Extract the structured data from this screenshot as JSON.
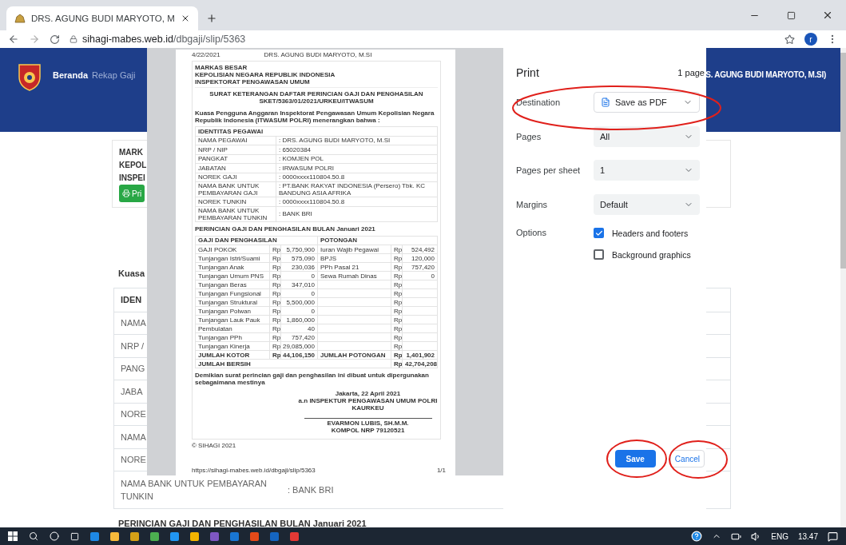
{
  "browser": {
    "tab": {
      "title": "DRS. AGUNG BUDI MARYOTO, M"
    },
    "url_host": "sihagi-mabes.web.id",
    "url_path": "/dbgaji/slip/5363",
    "profile": "r"
  },
  "site": {
    "nav": [
      {
        "label": "Beranda",
        "selected": true
      },
      {
        "label": "Rekap Gaji",
        "selected": false
      }
    ],
    "user": "S. AGUNG BUDI MARYOTO, M.SI)",
    "header_lines": [
      "MARK",
      "KEPOL",
      "INSPEI"
    ],
    "print_button": "Pri",
    "intro": "Kuasa",
    "table_rows": [
      {
        "kind": "heading",
        "label": "IDEN"
      },
      {
        "kind": "row",
        "label": "NAMA"
      },
      {
        "kind": "row",
        "label": "NRP /"
      },
      {
        "kind": "row",
        "label": "PANG"
      },
      {
        "kind": "row",
        "label": "JABA"
      },
      {
        "kind": "row",
        "label": "NORE"
      },
      {
        "kind": "row",
        "label": "NAMA"
      },
      {
        "kind": "row",
        "label": "NORE"
      },
      {
        "kind": "row",
        "label": "NAMA BANK UNTUK PEMBAYARAN TUNKIN",
        "value": ": BANK BRI"
      }
    ],
    "section_title": "PERINCIAN GAJI DAN PENGHASILAN BULAN Januari 2021"
  },
  "preview": {
    "date": "4/22/2021",
    "doc_title": "DRS. AGUNG BUDI MARYOTO, M.SI",
    "org": [
      "MARKAS BESAR",
      "KEPOLISIAN NEGARA REPUBLIK INDONESIA",
      "INSPEKTORAT PENGAWASAN UMUM"
    ],
    "title": "SURAT KETERANGAN DAFTAR PERINCIAN GAJI DAN PENGHASILAN",
    "number": "SKET/5363/01/2021/URKEU/ITWASUM",
    "intro": "Kuasa Pengguna Anggaran Inspektorat Pengawasan Umum Kepolisian Negara Republik Indonesia (ITWASUM POLRI) menerangkan bahwa :",
    "identity_heading": "IDENTITAS PEGAWAI",
    "identity": [
      {
        "label": "NAMA PEGAWAI",
        "value": ": DRS. AGUNG BUDI MARYOTO, M.SI"
      },
      {
        "label": "NRP / NIP",
        "value": ": 65020384"
      },
      {
        "label": "PANGKAT",
        "value": ": KOMJEN POL"
      },
      {
        "label": "JABATAN",
        "value": ": IRWASUM POLRI"
      },
      {
        "label": "NOREK GAJI",
        "value": ": 0000xxxx110804.50.8"
      },
      {
        "label": "NAMA BANK UNTUK PEMBAYARAN GAJI",
        "value": ": PT.BANK RAKYAT INDONESIA (Persero) Tbk. KC BANDUNG ASIA AFRIKA"
      },
      {
        "label": "NOREK TUNKIN",
        "value": ": 0000xxxx110804.50.8"
      },
      {
        "label": "NAMA BANK UNTUK PEMBAYARAN TUNKIN",
        "value": ": BANK BRI"
      }
    ],
    "salary_title": "PERINCIAN GAJI DAN PENGHASILAN BULAN Januari 2021",
    "earnings_heading": "GAJI DAN PENGHASILAN",
    "deductions_heading": "POTONGAN",
    "rows": [
      {
        "kind": "item",
        "e_label": "GAJI POKOK",
        "e_cur": "Rp",
        "e_amt": "5,750,900",
        "d_label": "Iuran Wajib Pegawai",
        "d_cur": "Rp",
        "d_amt": "524,492"
      },
      {
        "kind": "item",
        "e_label": "Tunjangan Istri/Suami",
        "e_cur": "Rp",
        "e_amt": "575,090",
        "d_label": "BPJS",
        "d_cur": "Rp",
        "d_amt": "120,000"
      },
      {
        "kind": "item",
        "e_label": "Tunjangan Anak",
        "e_cur": "Rp",
        "e_amt": "230,036",
        "d_label": "PPh Pasal 21",
        "d_cur": "Rp",
        "d_amt": "757,420"
      },
      {
        "kind": "item",
        "e_label": "Tunjangan Umum PNS",
        "e_cur": "Rp",
        "e_amt": "0",
        "d_label": "Sewa Rumah Dinas",
        "d_cur": "Rp",
        "d_amt": "0"
      },
      {
        "kind": "item",
        "e_label": "Tunjangan Beras",
        "e_cur": "Rp",
        "e_amt": "347,010",
        "d_cur": "Rp"
      },
      {
        "kind": "item",
        "e_label": "Tunjangan Fungsional",
        "e_cur": "Rp",
        "e_amt": "0",
        "d_cur": "Rp"
      },
      {
        "kind": "item",
        "e_label": "Tunjangan Struktural",
        "e_cur": "Rp",
        "e_amt": "5,500,000",
        "d_cur": "Rp"
      },
      {
        "kind": "item",
        "e_label": "Tunjangan Polwan",
        "e_cur": "Rp",
        "e_amt": "0",
        "d_cur": "Rp"
      },
      {
        "kind": "item",
        "e_label": "Tunjangan Lauk Pauk",
        "e_cur": "Rp",
        "e_amt": "1,860,000",
        "d_cur": "Rp"
      },
      {
        "kind": "item",
        "e_label": "Pembulatan",
        "e_cur": "Rp",
        "e_amt": "40",
        "d_cur": "Rp"
      },
      {
        "kind": "item",
        "e_label": "Tunjangan PPh",
        "e_cur": "Rp",
        "e_amt": "757,420",
        "d_cur": "Rp"
      },
      {
        "kind": "item",
        "e_label": "Tunjangan Kinerja",
        "e_cur": "Rp",
        "e_amt": "29,085,000",
        "d_cur": "Rp"
      },
      {
        "kind": "total",
        "e_label": "JUMLAH KOTOR",
        "e_cur": "Rp",
        "e_amt": "44,106,150",
        "d_label": "JUMLAH POTONGAN",
        "d_cur": "Rp",
        "d_amt": "1,401,902"
      },
      {
        "kind": "net",
        "e_label": "JUMLAH BERSIH",
        "d_cur": "Rp",
        "d_amt": "42,704,208"
      }
    ],
    "statement": "Demikian surat perincian gaji dan penghasilan ini dibuat untuk dipergunakan sebagaimana mestinya",
    "signature": [
      "Jakarta, 22 April 2021",
      "a.n INSPEKTUR PENGAWASAN UMUM POLRI",
      "KAURKEU"
    ],
    "signer": [
      "EVARMON LUBIS, SH.M.M.",
      "KOMPOL NRP 79120521"
    ],
    "copyright": "© SIHAGI 2021",
    "footer_url": "https://sihagi-mabes.web.id/dbgaji/slip/5363",
    "footer_page": "1/1"
  },
  "print": {
    "title": "Print",
    "page_count": "1 page",
    "settings": [
      {
        "kind": "destination",
        "label": "Destination",
        "value": "Save as PDF"
      },
      {
        "kind": "select",
        "label": "Pages",
        "value": "All"
      },
      {
        "kind": "select",
        "label": "Pages per sheet",
        "value": "1"
      },
      {
        "kind": "select",
        "label": "Margins",
        "value": "Default"
      },
      {
        "kind": "checkboxes",
        "label": "Options",
        "options": [
          {
            "label": "Headers and footers",
            "checked": true
          },
          {
            "label": "Background graphics",
            "checked": false
          }
        ]
      }
    ],
    "buttons": [
      {
        "kind": "primary",
        "label": "Save"
      },
      {
        "kind": "secondary",
        "label": "Cancel"
      }
    ]
  },
  "taskbar": {
    "language": "ENG",
    "time": "13.47"
  }
}
